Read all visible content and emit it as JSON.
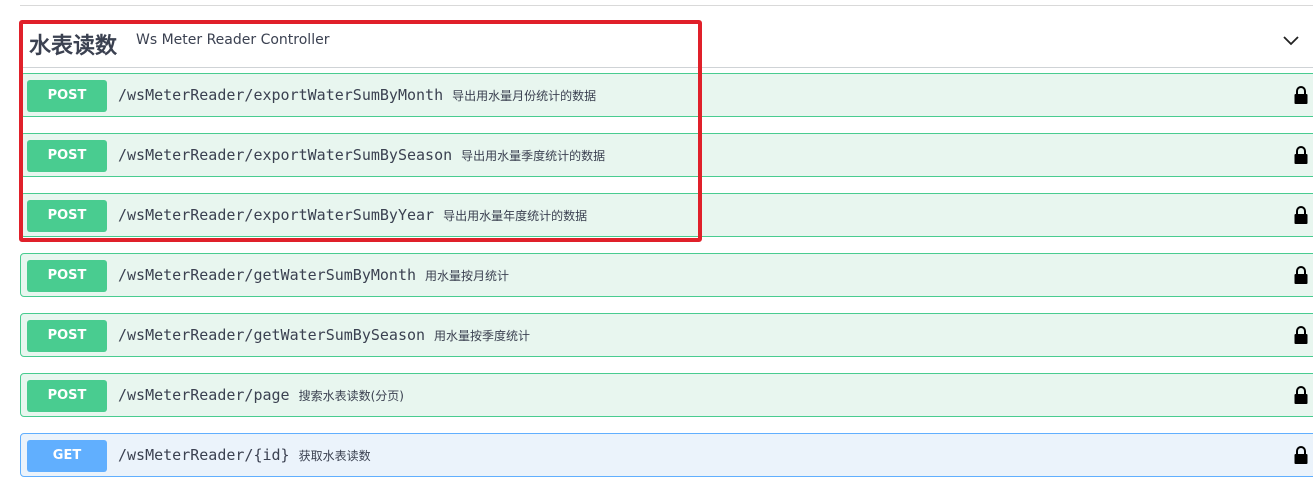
{
  "tag": {
    "name": "水表读数",
    "description": "Ws Meter Reader Controller"
  },
  "operations": [
    {
      "method": "POST",
      "path": "/wsMeterReader/exportWaterSumByMonth",
      "summary": "导出用水量月份统计的数据"
    },
    {
      "method": "POST",
      "path": "/wsMeterReader/exportWaterSumBySeason",
      "summary": "导出用水量季度统计的数据"
    },
    {
      "method": "POST",
      "path": "/wsMeterReader/exportWaterSumByYear",
      "summary": "导出用水量年度统计的数据"
    },
    {
      "method": "POST",
      "path": "/wsMeterReader/getWaterSumByMonth",
      "summary": "用水量按月统计"
    },
    {
      "method": "POST",
      "path": "/wsMeterReader/getWaterSumBySeason",
      "summary": "用水量按季度统计"
    },
    {
      "method": "POST",
      "path": "/wsMeterReader/page",
      "summary": "搜索水表读数(分页)"
    },
    {
      "method": "GET",
      "path": "/wsMeterReader/{id}",
      "summary": "获取水表读数"
    }
  ],
  "icons": {
    "expand": "chevron-down-icon",
    "lock": "lock-icon"
  },
  "colors": {
    "post": "#49cc90",
    "get": "#61affe",
    "highlight": "#e0202a"
  }
}
